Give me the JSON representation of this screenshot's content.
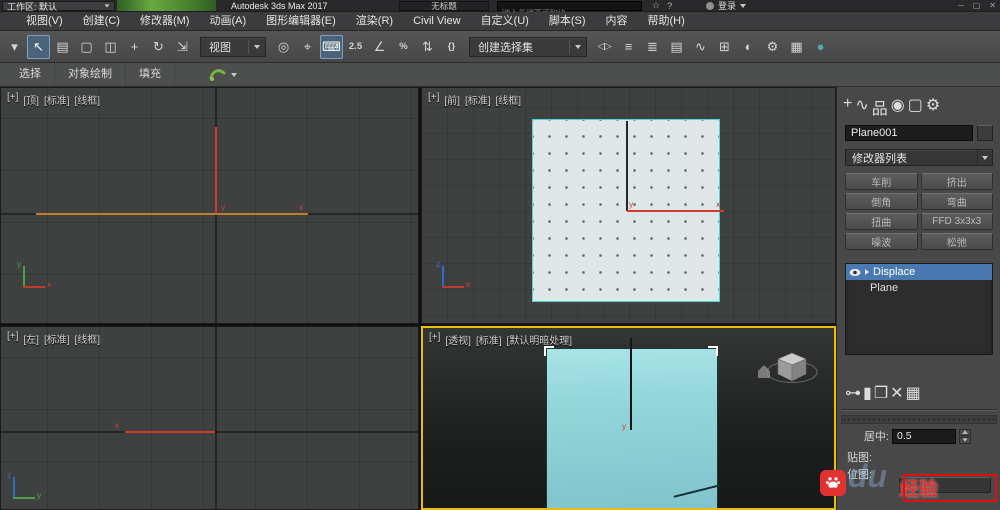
{
  "colors": {
    "active_viewport_border": "#edbe00",
    "object_cyan": "#8fd6da",
    "selection_highlight": "#4a79b2",
    "watermark_red": "#e23230"
  },
  "title_bar": {
    "workspace_label": "工作区: 默认",
    "app_title": "Autodesk 3ds Max 2017",
    "doc_title": "无标题",
    "search_placeholder": "键入关键字或短语",
    "sign_in_label": "登录",
    "infocenter_icons": [
      {
        "name": "favorites-star-icon",
        "glyph": "☆"
      },
      {
        "name": "help-icon",
        "glyph": "?"
      }
    ],
    "window_icons": [
      {
        "name": "minimize-icon",
        "glyph": "─"
      },
      {
        "name": "restore-icon",
        "glyph": "▢"
      },
      {
        "name": "close-icon",
        "glyph": "✕"
      }
    ]
  },
  "menu_bar": {
    "items": [
      {
        "name": "menu-views",
        "label": "视图(V)"
      },
      {
        "name": "menu-create",
        "label": "创建(C)"
      },
      {
        "name": "menu-modifiers",
        "label": "修改器(M)"
      },
      {
        "name": "menu-animation",
        "label": "动画(A)"
      },
      {
        "name": "menu-graph-editors",
        "label": "图形编辑器(E)"
      },
      {
        "name": "menu-rendering",
        "label": "渲染(R)"
      },
      {
        "name": "menu-civil-view",
        "label": "Civil View"
      },
      {
        "name": "menu-customize",
        "label": "自定义(U)"
      },
      {
        "name": "menu-scripting",
        "label": "脚本(S)"
      },
      {
        "name": "menu-content",
        "label": "内容"
      },
      {
        "name": "menu-help",
        "label": "帮助(H)"
      }
    ]
  },
  "toolbar": {
    "coordsys_value": "视图",
    "selection_set_value": "创建选择集",
    "icons_left": [
      {
        "name": "toolbar-flyout-icon",
        "glyph": "▾"
      },
      {
        "name": "select-object-icon",
        "glyph": "↖",
        "cls": "active"
      },
      {
        "name": "select-by-name-icon",
        "glyph": "▤"
      },
      {
        "name": "selection-region-icon",
        "glyph": "▢"
      },
      {
        "name": "window-crossing-icon",
        "glyph": "◫"
      },
      {
        "name": "select-and-move-icon",
        "glyph": "+"
      },
      {
        "name": "select-and-rotate-icon",
        "glyph": "↻"
      },
      {
        "name": "select-and-scale-icon",
        "glyph": "⇲"
      }
    ],
    "icons_mid": [
      {
        "name": "use-pivot-center-icon",
        "glyph": "◎"
      },
      {
        "name": "select-and-manipulate-icon",
        "glyph": "⌖"
      },
      {
        "name": "keyboard-override-icon",
        "glyph": "⌨",
        "cls": "active"
      },
      {
        "name": "snaps-toggle-icon",
        "glyph": "2.5",
        "cls": "small-text"
      },
      {
        "name": "angle-snap-icon",
        "glyph": "∠"
      },
      {
        "name": "percent-snap-icon",
        "glyph": "%",
        "cls": "small-text"
      },
      {
        "name": "spinner-snap-icon",
        "glyph": "⇅"
      },
      {
        "name": "edit-named-sets-icon",
        "glyph": "{}",
        "cls": "small-text"
      }
    ],
    "icons_right": [
      {
        "name": "mirror-icon",
        "glyph": "◁▷",
        "cls": "small-text"
      },
      {
        "name": "align-icon",
        "glyph": "≡"
      },
      {
        "name": "layer-manager-icon",
        "glyph": "≣"
      },
      {
        "name": "scene-explorer-icon",
        "glyph": "▤"
      },
      {
        "name": "curve-editor-icon",
        "glyph": "∿"
      },
      {
        "name": "schematic-view-icon",
        "glyph": "⊞"
      },
      {
        "name": "material-editor-icon",
        "glyph": "◐"
      },
      {
        "name": "render-setup-icon",
        "glyph": "⚙"
      },
      {
        "name": "rendered-frame-icon",
        "glyph": "▦"
      },
      {
        "name": "render-production-icon",
        "glyph": "●",
        "color": "#4fa8a8"
      }
    ]
  },
  "ribbon": {
    "tabs": [
      {
        "name": "ribbon-tab-select",
        "label": "选择"
      },
      {
        "name": "ribbon-tab-object-paint",
        "label": "对象绘制"
      },
      {
        "name": "ribbon-tab-populate",
        "label": "填充"
      }
    ]
  },
  "axis": {
    "x": "x",
    "y": "y",
    "z": "z"
  },
  "viewports": {
    "top_left": {
      "menus": [
        {
          "name": "vp-top-plus-menu",
          "label": "[+]"
        },
        {
          "name": "vp-top-pov-menu",
          "label": "[顶]"
        },
        {
          "name": "vp-top-standard-menu",
          "label": "[标准]"
        },
        {
          "name": "vp-top-shading-menu",
          "label": "[线框]"
        }
      ]
    },
    "top_right": {
      "menus": [
        {
          "name": "vp-front-plus-menu",
          "label": "[+]"
        },
        {
          "name": "vp-front-pov-menu",
          "label": "[前]"
        },
        {
          "name": "vp-front-standard-menu",
          "label": "[标准]"
        },
        {
          "name": "vp-front-shading-menu",
          "label": "[线框]"
        }
      ]
    },
    "bottom_left": {
      "menus": [
        {
          "name": "vp-left-plus-menu",
          "label": "[+]"
        },
        {
          "name": "vp-left-pov-menu",
          "label": "[左]"
        },
        {
          "name": "vp-left-standard-menu",
          "label": "[标准]"
        },
        {
          "name": "vp-left-shading-menu",
          "label": "[线框]"
        }
      ]
    },
    "bottom_right": {
      "menus": [
        {
          "name": "vp-persp-plus-menu",
          "label": "[+]"
        },
        {
          "name": "vp-persp-pov-menu",
          "label": "[透视]"
        },
        {
          "name": "vp-persp-standard-menu",
          "label": "[标准]"
        },
        {
          "name": "vp-persp-shading-menu",
          "label": "[默认明暗处理]"
        }
      ]
    }
  },
  "command_panel": {
    "tabs": [
      {
        "name": "tab-create",
        "glyph": "+"
      },
      {
        "name": "tab-modify",
        "glyph": "∿",
        "cls": "active"
      },
      {
        "name": "tab-hierarchy",
        "glyph": "品"
      },
      {
        "name": "tab-motion",
        "glyph": "◉"
      },
      {
        "name": "tab-display",
        "glyph": "▢"
      },
      {
        "name": "tab-utilities",
        "glyph": "⚙"
      }
    ],
    "object_name": "Plane001",
    "modifier_list_label": "修改器列表",
    "modifier_buttons": [
      {
        "name": "modifier-button-lathe",
        "label": "车削"
      },
      {
        "name": "modifier-button-extrude",
        "label": "挤出"
      },
      {
        "name": "modifier-button-bevel",
        "label": "倒角"
      },
      {
        "name": "modifier-button-bend",
        "label": "弯曲"
      },
      {
        "name": "modifier-button-twist",
        "label": "扭曲"
      },
      {
        "name": "modifier-button-ffd3x3x3",
        "label": "FFD 3x3x3"
      },
      {
        "name": "modifier-button-noise",
        "label": "噪波"
      },
      {
        "name": "modifier-button-relax",
        "label": "松弛"
      }
    ],
    "stack": {
      "selected": "Displace",
      "base": "Plane"
    },
    "stack_tools": [
      {
        "name": "pin-stack-icon",
        "glyph": "⊶"
      },
      {
        "name": "show-end-result-icon",
        "glyph": "▮",
        "cls": "hl-blue"
      },
      {
        "name": "make-unique-icon",
        "glyph": "❒"
      },
      {
        "name": "remove-modifier-icon",
        "glyph": "✕"
      },
      {
        "name": "configure-modifier-sets-icon",
        "glyph": "▦",
        "cls": "hl-teal"
      }
    ],
    "params": {
      "center_label": "居中:",
      "center_value": "0.5",
      "map_label": "贴图:",
      "bitmap_label": "位图:"
    }
  },
  "watermark": {
    "brand_faded": "du",
    "text": "经验"
  }
}
